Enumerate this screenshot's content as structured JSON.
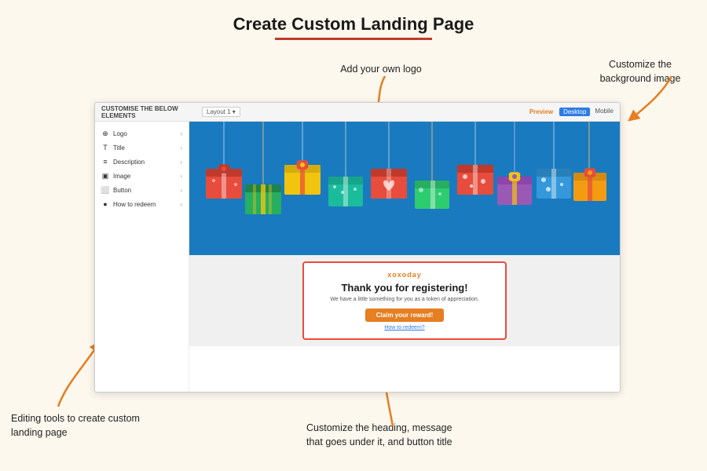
{
  "page": {
    "title": "Create Custom Landing Page",
    "title_underline_color": "#c0392b"
  },
  "annotations": {
    "logo_label": "Add your own logo",
    "bg_label": "Customize the background image",
    "editing_label": "Editing tools to create custom landing page",
    "heading_label": "Customize the heading, message that goes under it, and button title"
  },
  "topbar": {
    "left_label": "CUSTOMISE THE BELOW ELEMENTS",
    "layout_label": "Layout 1",
    "preview_label": "Preview",
    "desktop_label": "Desktop",
    "mobile_label": "Mobile"
  },
  "sidebar": {
    "items": [
      {
        "icon": "🖼",
        "label": "Logo"
      },
      {
        "icon": "T",
        "label": "Title"
      },
      {
        "icon": "≡",
        "label": "Description"
      },
      {
        "icon": "🖼",
        "label": "Image"
      },
      {
        "icon": "⬜",
        "label": "Button"
      },
      {
        "icon": "❓",
        "label": "How to redeem"
      }
    ]
  },
  "card": {
    "brand": "xoxoday",
    "heading": "Thank you for registering!",
    "subtext": "We have a little something for you as a token of appreciation.",
    "button_label": "Claim your reward!",
    "link_label": "How to redeem?"
  },
  "colors": {
    "background": "#fdf8ee",
    "arrow": "#e67e22",
    "banner": "#1a7abf",
    "accent": "#e74c3c"
  }
}
